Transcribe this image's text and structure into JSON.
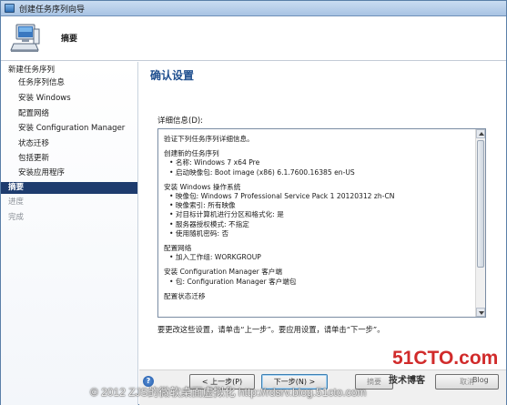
{
  "window": {
    "title": "创建任务序列向导"
  },
  "header": {
    "page_heading": "摘要"
  },
  "nav": {
    "items": [
      {
        "label": "新建任务序列",
        "level": 1
      },
      {
        "label": "任务序列信息",
        "level": 2
      },
      {
        "label": "安装 Windows",
        "level": 2
      },
      {
        "label": "配置网络",
        "level": 2
      },
      {
        "label": "安装 Configuration Manager",
        "level": 2
      },
      {
        "label": "状态迁移",
        "level": 2
      },
      {
        "label": "包括更新",
        "level": 2
      },
      {
        "label": "安装应用程序",
        "level": 2
      },
      {
        "label": "摘要",
        "level": 1,
        "active": true
      },
      {
        "label": "进度",
        "level": 1
      },
      {
        "label": "完成",
        "level": 1
      }
    ]
  },
  "content": {
    "title": "确认设置",
    "details_label": "详细信息(D):",
    "details": {
      "intro": "验证下列任务序列详细信息。",
      "sections": [
        {
          "title": "创建新的任务序列",
          "items": [
            "名称: Windows 7 x64 Pre",
            "启动映像包: Boot image (x86) 6.1.7600.16385 en-US"
          ]
        },
        {
          "title": "安装 Windows 操作系统",
          "items": [
            "映像包: Windows 7 Professional Service Pack 1 20120312 zh-CN",
            "映像索引: 所有映像",
            "对目标计算机进行分区和格式化: 是",
            "服务器授权模式: 不指定",
            "使用随机密码: 否"
          ]
        },
        {
          "title": "配置网络",
          "items": [
            "加入工作组: WORKGROUP"
          ]
        },
        {
          "title": "安装 Configuration Manager 客户端",
          "items": [
            "包: Configuration Manager 客户端包"
          ]
        },
        {
          "title": "配置状态迁移",
          "items": []
        }
      ]
    },
    "hint": "要更改这些设置，请单击“上一步”。要应用设置，请单击“下一步”。"
  },
  "footer": {
    "help_glyph": "?",
    "prev_label": "< 上一步(P)",
    "next_label": "下一步(N) >",
    "summary_label": "摘要",
    "cancel_label": "取消"
  },
  "watermark": {
    "logo": "51CTO.com",
    "sub": "技术博客",
    "blog": "Blog",
    "copyright": "© 2012 ZJS的微软桌面虚拟化 http://rdsrv.blog.51cto.com"
  },
  "colors": {
    "nav_active_bg": "#1e3c6e",
    "title_blue": "#1f4f8f",
    "watermark_red": "#d12b2b"
  }
}
